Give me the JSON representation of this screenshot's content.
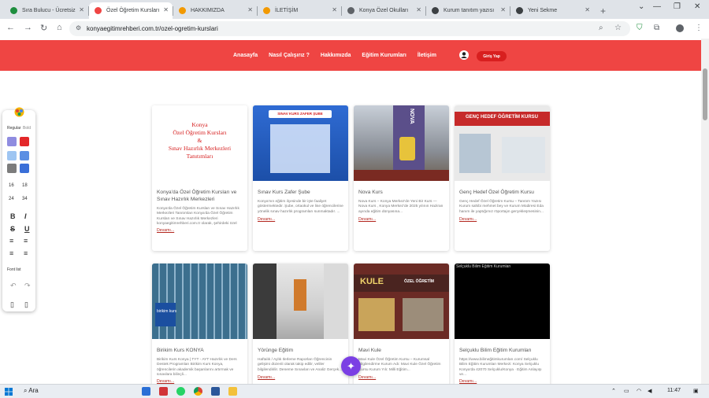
{
  "browser": {
    "tabs": [
      {
        "label": "Sıra Bulucu - Ücretsiz",
        "color": "#1e8e3e",
        "active": false
      },
      {
        "label": "Özel Öğretim Kursları",
        "color": "#ef4543",
        "active": true
      },
      {
        "label": "HAKKIMIZDA",
        "color": "#f29900",
        "active": false
      },
      {
        "label": "İLETİŞİM",
        "color": "#f29900",
        "active": false
      },
      {
        "label": "Konya Özel Okulları",
        "color": "#5f6368",
        "active": false
      },
      {
        "label": "Kurum tanıtım yazısı",
        "color": "#3c4043",
        "active": false
      },
      {
        "label": "Yeni Sekme",
        "color": "#3c4043",
        "active": false
      }
    ],
    "new_tab": "+",
    "url": "konyaegitimrehberi.com.tr/ozel-ogretim-kurslari"
  },
  "site": {
    "nav": [
      "Anasayfa",
      "Nasıl Çalışırız ?",
      "Hakkımızda",
      "Eğitim Kurumları",
      "İletişim"
    ],
    "login": "Giriş Yap"
  },
  "cards": [
    {
      "image_label_lines": [
        "Konya",
        "Özel Öğretim Kursları",
        "&",
        "Sınav Hazırlık Merkezleri",
        "Tanıtımları"
      ],
      "title": "Konya'da Özel Öğretim Kursları ve Sınav Hazırlık Merkezleri",
      "text": "Konya'da Özel Öğretim Kursları ve Sınav Hazırlık Merkezleri Tanıtımları Konya'da Özel Öğretim Kursları ve Sınav Hazırlık Merkezleri konyaegitimrehberi.com.tr olarak, şehirdeki özel öğretim kursları, TYT - AYT...",
      "more": "Devamı..."
    },
    {
      "image_label_lines": [
        "SINAV KURS ZAFER ŞUBE"
      ],
      "title": "Sınav Kurs Zafer Şube",
      "text": "Konya'nın eğitim ilçesinde bir işte faaliyet göstermektedir. Şube, ortaokul ve lise öğrencilerine yönelik sınav hazırlık programları sunmaktadır. ...",
      "more": "Devamı..."
    },
    {
      "image_label_lines": [
        "NOVA"
      ],
      "title": "Nova Kurs",
      "text": "Nova Kurs – Konya Merkez'de Yeni Bir Kurs — Nova Kurs , Konya Merkez'de 2025 yılının Haziran ayında eğitim dünyasına...",
      "more": "Devamı..."
    },
    {
      "image_label_lines": [
        "GENÇ HEDEF ÖĞRETİM KURSU"
      ],
      "title": "Genç Hedef Özel Öğretim Kursu",
      "text": "Genç Hedef Özel Öğretim Kursu – Tanıtım Yazısı Kurum sahibi mehmet bey ve Kurum Müdiresi Eda hanım ile yaptığımız röportajın gerçekleşmesinin...",
      "more": "Devamı..."
    },
    {
      "image_label_lines": [
        "birikim kurs"
      ],
      "title": "Birikim Kurs KONYA",
      "text": "Birikim Kurs Konya | TYT - AYT Hazırlık ve Ders Destek Programları Birikim Kurs Konya, öğrencilerin akademik başarılarını artırmak ve sınavlara bilinçli...",
      "more": "Devamı..."
    },
    {
      "image_label_lines": [],
      "title": "Yörünge Eğitim",
      "text": "Haftalık / Aylık Ilerleme Raporları Öğrencinin gelişimi düzenli olarak takip edilir, veliler bilgilendirilir. Deneme Sınavları ve Analiz Gerçek...",
      "more": "Devamı..."
    },
    {
      "image_label_lines": [
        "KULE",
        "ÖZEL ÖĞRETİM"
      ],
      "title": "Mavi Kule",
      "text": "Mavi Kule Özel Öğretim Kursu – Kurumsal Bilgilendirme Kurum Adı: Mavi Kule Özel Öğretim Kursu Kurum Yılı: Milli Eğitim...",
      "more": "Devamı..."
    },
    {
      "image_label_lines": [
        "Selçuklu Bilim Eğitim Kurumları"
      ],
      "title": "Selçuklu Bilim Eğitim Kurumları",
      "text": "https://www.bilimeğitimkurumları.com/ Selçuklu Bilim Eğitim Kurumları Merkezi: Konya Selçuklu Konya'da 42070 Selçuklu/Konya · Eğitim Anlayışı ve...",
      "more": "Devamı..."
    }
  ],
  "widget": {
    "tab_a": "Regular",
    "tab_b": "Bold",
    "colors": [
      "#8f8ce0",
      "#e3282a",
      "#9ec5f2",
      "#5b8fe3",
      "#7c7c7c",
      "#3a6fd8"
    ],
    "sizes": [
      "16",
      "18",
      "24",
      "34"
    ],
    "fontlist": "Font list"
  },
  "taskbar": {
    "search": "Ara",
    "time": "11:47"
  }
}
